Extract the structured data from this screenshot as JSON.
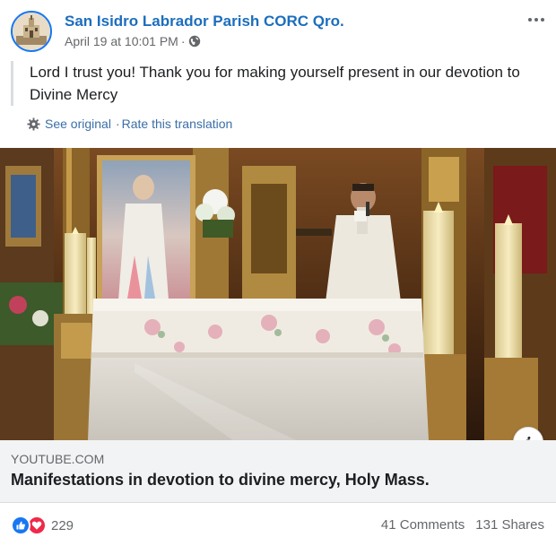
{
  "post": {
    "page_name": "San Isidro Labrador Parish CORC Qro.",
    "timestamp": "April 19 at 10:01 PM",
    "separator": "·",
    "audience_icon": "globe-icon",
    "text": "Lord I trust you! Thank you for making yourself present in our devotion to Divine Mercy"
  },
  "translation": {
    "icon": "gear-icon",
    "see_original": "See original",
    "separator": "·",
    "rate": "Rate this translation"
  },
  "link_preview": {
    "domain": "YOUTUBE.COM",
    "title": "Manifestations in devotion to divine mercy, Holy Mass.",
    "info_label": "i"
  },
  "footer": {
    "reaction_icons": [
      "like-icon",
      "love-icon"
    ],
    "reaction_count": "229",
    "comments": "41 Comments",
    "shares": "131 Shares"
  },
  "colors": {
    "link": "#1c6ebd",
    "like": "#1877f2",
    "love": "#f02849",
    "muted": "#65676b",
    "card_bg": "#f2f3f5"
  }
}
